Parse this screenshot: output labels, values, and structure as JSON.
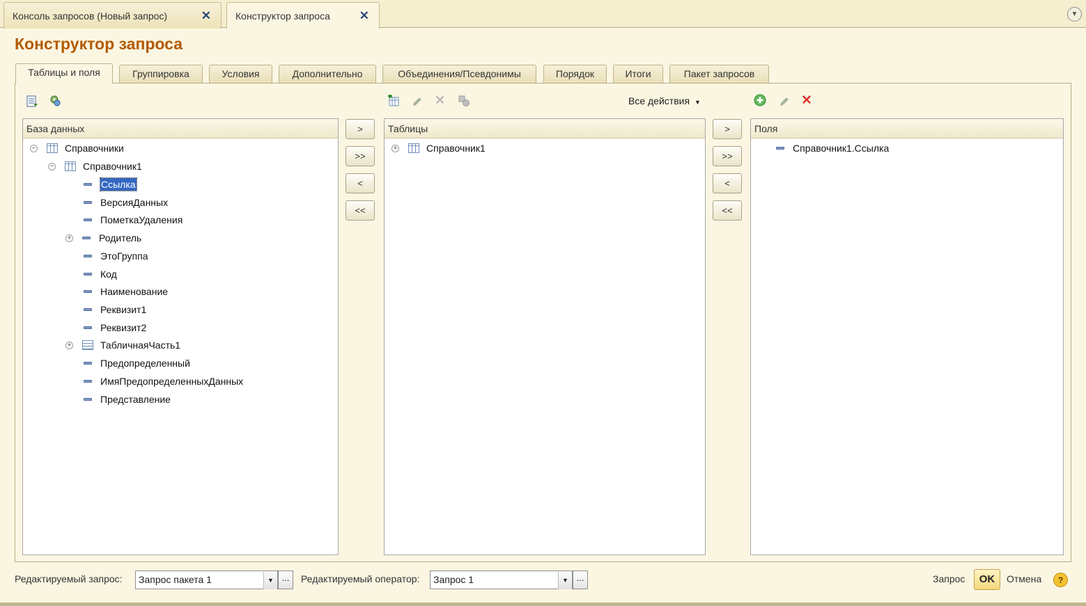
{
  "window_tabs": [
    {
      "label": "Консоль запросов (Новый запрос)"
    },
    {
      "label": "Конструктор запроса"
    }
  ],
  "title": "Конструктор запроса",
  "tabs": [
    "Таблицы и поля",
    "Группировка",
    "Условия",
    "Дополнительно",
    "Объединения/Псевдонимы",
    "Порядок",
    "Итоги",
    "Пакет запросов"
  ],
  "database_panel": {
    "header": "База данных",
    "items": [
      {
        "label": "Справочники"
      },
      {
        "label": "Справочник1"
      },
      {
        "label": "Ссылка"
      },
      {
        "label": "ВерсияДанных"
      },
      {
        "label": "ПометкаУдаления"
      },
      {
        "label": "Родитель"
      },
      {
        "label": "ЭтоГруппа"
      },
      {
        "label": "Код"
      },
      {
        "label": "Наименование"
      },
      {
        "label": "Реквизит1"
      },
      {
        "label": "Реквизит2"
      },
      {
        "label": "ТабличнаяЧасть1"
      },
      {
        "label": "Предопределенный"
      },
      {
        "label": "ИмяПредопределенныхДанных"
      },
      {
        "label": "Представление"
      }
    ]
  },
  "tables_panel": {
    "header": "Таблицы",
    "items": [
      {
        "label": "Справочник1"
      }
    ],
    "all_actions": "Все действия"
  },
  "fields_panel": {
    "header": "Поля",
    "items": [
      {
        "label": "Справочник1.Ссылка"
      }
    ]
  },
  "move_buttons": {
    "one": ">",
    "all": ">>",
    "back": "<",
    "back_all": "<<"
  },
  "bottom": {
    "edited_query_label": "Редактируемый запрос:",
    "edited_query_value": "Запрос пакета 1",
    "edited_operator_label": "Редактируемый оператор:",
    "edited_operator_value": "Запрос 1",
    "query_link": "Запрос",
    "ok": "OK",
    "cancel": "Отмена",
    "help": "?"
  }
}
